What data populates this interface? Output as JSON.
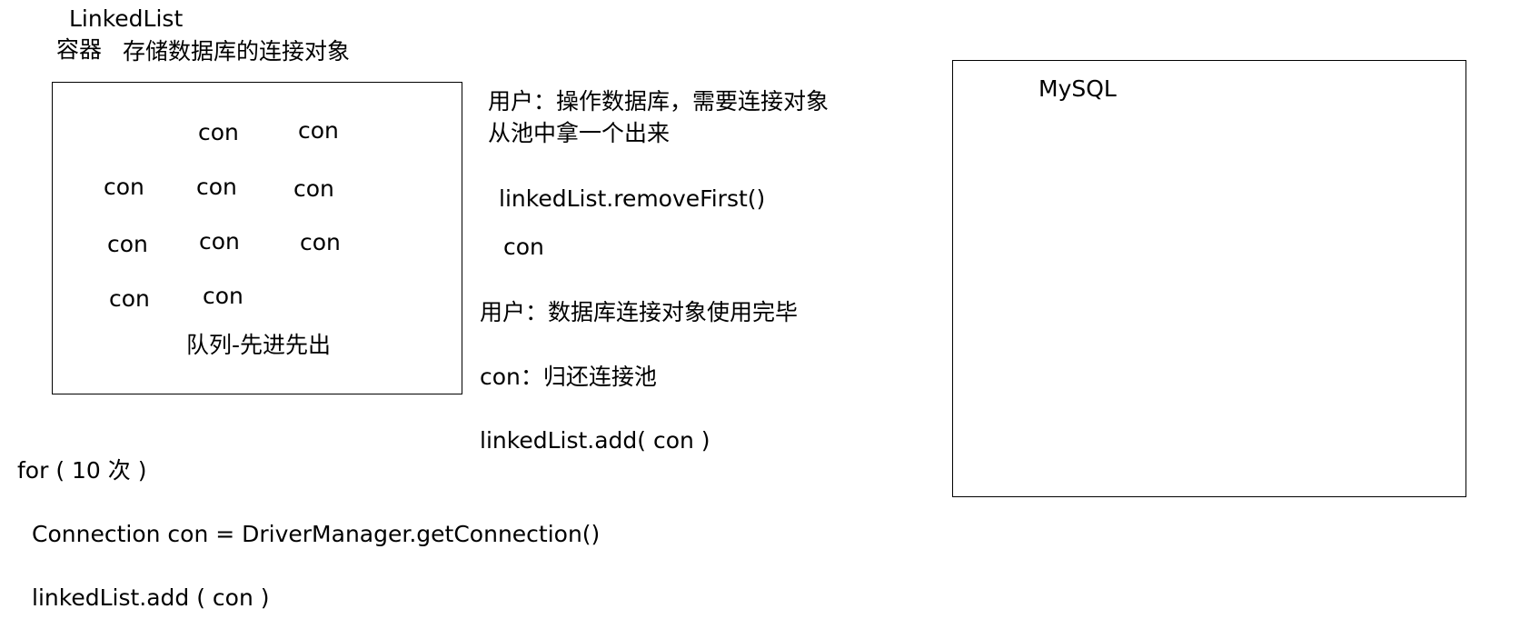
{
  "header": {
    "linkedlist_label": "LinkedList",
    "container_label": "容器",
    "container_desc": "存储数据库的连接对象"
  },
  "pool": {
    "cons": [
      "con",
      "con",
      "con",
      "con",
      "con",
      "con",
      "con",
      "con",
      "con",
      "con"
    ],
    "queue_label": "队列-先进先出"
  },
  "flow": {
    "user_get_line1": "用户：操作数据库，需要连接对象",
    "user_get_line2": "从池中拿一个出来",
    "remove_call": "linkedList.removeFirst()",
    "removed_con": "con",
    "user_done": "用户：数据库连接对象使用完毕",
    "con_return": "con：归还连接池",
    "add_back_call": "linkedList.add( con )"
  },
  "init": {
    "loop": "for ( 10 次 )",
    "get_connection": "Connection con = DriverManager.getConnection()",
    "add_call": "linkedList.add ( con )"
  },
  "mysql": {
    "label": "MySQL"
  }
}
